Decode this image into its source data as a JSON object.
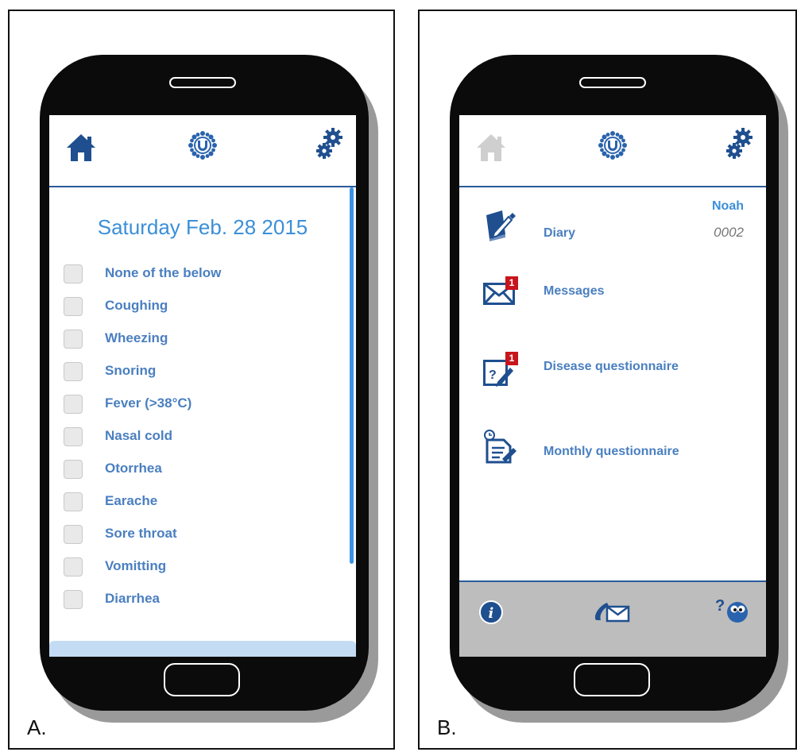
{
  "panels": {
    "a": {
      "label": "A.",
      "date_title": "Saturday Feb. 28 2015",
      "symptoms": [
        "None of the below",
        "Coughing",
        "Wheezing",
        "Snoring",
        "Fever (>38°C)",
        "Nasal cold",
        "Otorrhea",
        "Earache",
        "Sore throat",
        "Vomitting",
        "Diarrhea"
      ]
    },
    "b": {
      "label": "B.",
      "user_name": "Noah",
      "user_id": "0002",
      "menu": [
        {
          "label": "Diary",
          "icon": "diary-book-pen-icon"
        },
        {
          "label": "Messages",
          "icon": "envelope-icon",
          "badge": "1"
        },
        {
          "label": "Disease questionnaire",
          "icon": "questionnaire-edit-icon",
          "badge": "1"
        },
        {
          "label": "Monthly questionnaire",
          "icon": "monthly-document-icon"
        }
      ],
      "footer_icons": [
        "info-icon",
        "contact-mail-icon",
        "help-character-icon"
      ]
    }
  },
  "icons": {
    "header": [
      "home-icon",
      "logo-flower-u-icon",
      "settings-gears-icon"
    ]
  },
  "colors": {
    "accent_blue": "#2a5b9c",
    "text_blue": "#4a7fc0",
    "title_blue": "#3b8fd9",
    "badge_red": "#c8141c",
    "footer_gray": "#bdbdbd",
    "home_inactive": "#cfcfcf"
  }
}
